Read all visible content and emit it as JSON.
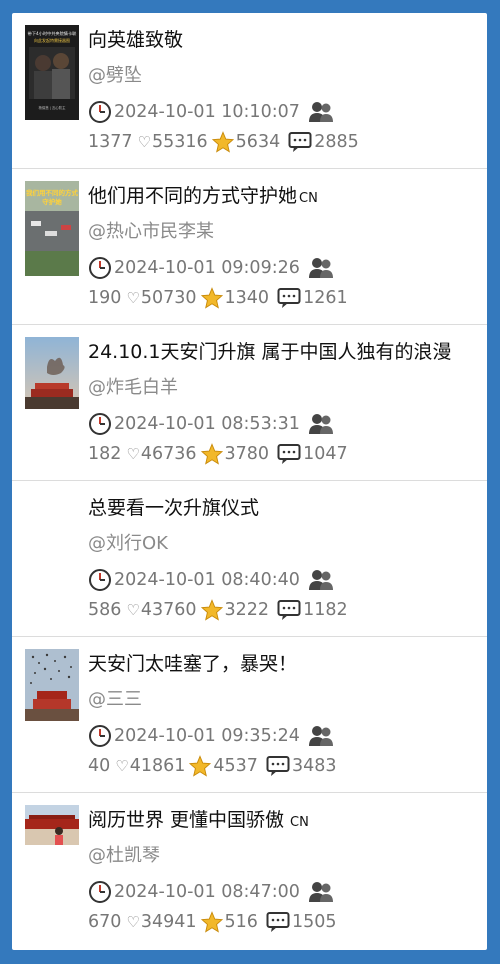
{
  "feed": [
    {
      "title": "向英雄致敬",
      "title_badge": "",
      "author": "@劈坠",
      "time": "2024-10-01 10:10:07",
      "views": "1377",
      "likes": "55316",
      "stars": "5634",
      "comments": "2885",
      "thumb": "dark-poster"
    },
    {
      "title": "他们用不同的方式守护她",
      "title_badge": "CN",
      "author": "@热心市民李某",
      "time": "2024-10-01 09:09:26",
      "views": "190",
      "likes": "50730",
      "stars": "1340",
      "comments": "1261",
      "thumb": "street"
    },
    {
      "title": "24.10.1天安门升旗 属于中国人独有的浪漫",
      "title_badge": "",
      "author": "@炸毛白羊",
      "time": "2024-10-01 08:53:31",
      "views": "182",
      "likes": "46736",
      "stars": "3780",
      "comments": "1047",
      "thumb": "sky-gate"
    },
    {
      "title": "总要看一次升旗仪式",
      "title_badge": "",
      "author": "@刘行OK",
      "time": "2024-10-01 08:40:40",
      "views": "586",
      "likes": "43760",
      "stars": "3222",
      "comments": "1182",
      "thumb": ""
    },
    {
      "title": "天安门太哇塞了，暴哭！",
      "title_badge": "",
      "author": "@三三",
      "time": "2024-10-01 09:35:24",
      "views": "40",
      "likes": "41861",
      "stars": "4537",
      "comments": "3483",
      "thumb": "birds-gate"
    },
    {
      "title": "阅历世界 更懂中国骄傲",
      "title_badge": "CN",
      "author": "@杜凯琴",
      "time": "2024-10-01 08:47:00",
      "views": "670",
      "likes": "34941",
      "stars": "516",
      "comments": "1505",
      "thumb": "gate-people"
    }
  ],
  "poster_text": {
    "line1": "带下4小时中共央院情卡联",
    "line2": "向此发起特需接器图",
    "line3": "杨保慧 | 瓦心防主"
  },
  "street_text": {
    "line1": "我们用不同的方式",
    "line2": "守护她"
  },
  "icons": {
    "clock": "clock-icon",
    "people": "people-icon",
    "heart": "heart-icon",
    "star": "star-icon",
    "comment": "comment-bubble-icon"
  },
  "colors": {
    "background": "#3479bd",
    "card": "#ffffff",
    "meta_text": "#777777",
    "star": "#f2b82a"
  }
}
